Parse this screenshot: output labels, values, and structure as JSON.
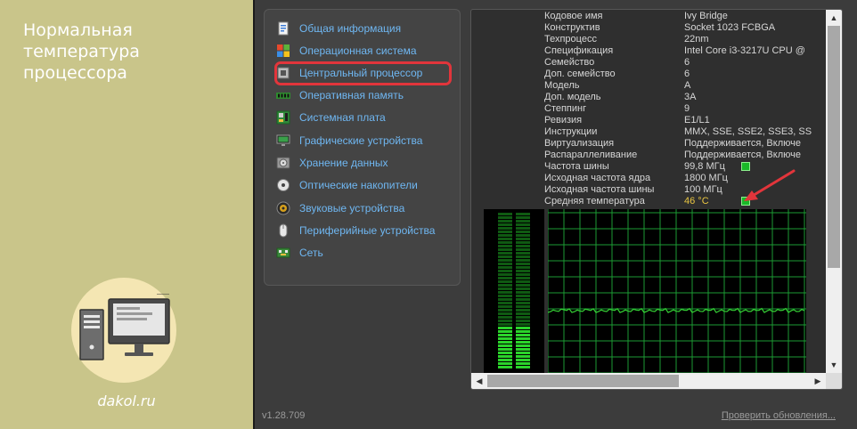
{
  "promo": {
    "title_line1": "Нормальная",
    "title_line2": "температура",
    "title_line3": "процессора",
    "site": "dakol.ru",
    "illustration_icon": "computer-icon"
  },
  "sidebar": {
    "items": [
      {
        "label": "Общая информация",
        "icon": "summary-icon"
      },
      {
        "label": "Операционная система",
        "icon": "windows-icon"
      },
      {
        "label": "Центральный процессор",
        "icon": "cpu-icon",
        "selected": true
      },
      {
        "label": "Оперативная память",
        "icon": "ram-icon"
      },
      {
        "label": "Системная плата",
        "icon": "motherboard-icon"
      },
      {
        "label": "Графические устройства",
        "icon": "monitor-icon"
      },
      {
        "label": "Хранение данных",
        "icon": "hdd-icon"
      },
      {
        "label": "Оптические накопители",
        "icon": "optical-disc-icon"
      },
      {
        "label": "Звуковые устройства",
        "icon": "speaker-icon"
      },
      {
        "label": "Периферийные устройства",
        "icon": "mouse-icon"
      },
      {
        "label": "Сеть",
        "icon": "network-icon"
      }
    ]
  },
  "details": {
    "rows": [
      {
        "key": "Кодовое имя",
        "value": "Ivy Bridge"
      },
      {
        "key": "Конструктив",
        "value": "Socket 1023 FCBGA"
      },
      {
        "key": "Техпроцесс",
        "value": "22nm"
      },
      {
        "key": "Спецификация",
        "value": "Intel Core i3-3217U CPU @"
      },
      {
        "key": "Семейство",
        "value": "6"
      },
      {
        "key": "Доп. семейство",
        "value": "6"
      },
      {
        "key": "Модель",
        "value": "A"
      },
      {
        "key": "Доп. модель",
        "value": "3A"
      },
      {
        "key": "Степпинг",
        "value": "9"
      },
      {
        "key": "Ревизия",
        "value": "E1/L1"
      },
      {
        "key": "Инструкции",
        "value": "MMX, SSE, SSE2, SSE3, SS"
      },
      {
        "key": "Виртуализация",
        "value": "Поддерживается, Включе"
      },
      {
        "key": "Распараллеливание",
        "value": "Поддерживается, Включе"
      },
      {
        "key": "Частота шины",
        "value": "99,8 МГц",
        "indicator": true
      },
      {
        "key": "Исходная частота ядра",
        "value": "1800 МГц"
      },
      {
        "key": "Исходная частота шины",
        "value": "100 МГц"
      },
      {
        "key": "Средняя температура",
        "value": "46 °C",
        "indicator": true,
        "highlight": true
      }
    ],
    "temperature_level": 0.46,
    "colors": {
      "graph_line": "#35d235",
      "graph_grid": "#1c9a33",
      "bar_fill": "#2bd42b",
      "bar_dim": "#0f5a12",
      "arrow": "#e2353b"
    }
  },
  "footer": {
    "version": "v1.28.709",
    "update_link": "Проверить обновления..."
  }
}
